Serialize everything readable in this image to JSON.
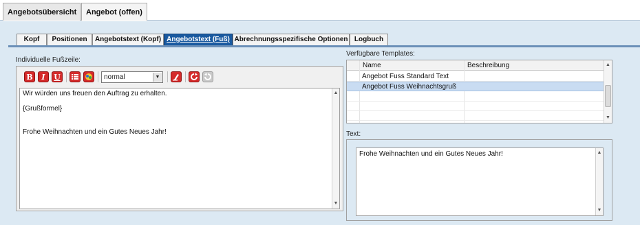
{
  "doc_tabs": [
    {
      "label": "Angebotsübersicht",
      "active": false
    },
    {
      "label": "Angebot (offen)",
      "active": true
    }
  ],
  "sub_tabs": [
    {
      "label": "Kopf",
      "active": false
    },
    {
      "label": "Positionen",
      "active": false
    },
    {
      "label": "Angebotstext (Kopf)",
      "active": false
    },
    {
      "label": "Angebotstext (Fuß)",
      "active": true
    },
    {
      "label": "Abrechnungsspezifische Optionen",
      "active": false
    },
    {
      "label": "Logbuch",
      "active": false
    }
  ],
  "footer_section": {
    "label": "Individuelle Fußzeile:",
    "toolbar": {
      "bold": "B",
      "italic": "I",
      "underline": "U",
      "format_select_value": "normal",
      "icons": [
        "bold-icon",
        "italic-icon",
        "underline-icon",
        "list-icon",
        "color-icon",
        "clear-format-icon",
        "undo-icon",
        "redo-icon"
      ]
    },
    "lines": [
      "Wir würden uns freuen den Auftrag zu erhalten.",
      "{Grußformel}",
      "",
      "Frohe Weihnachten und ein Gutes Neues Jahr!"
    ]
  },
  "templates": {
    "label": "Verfügbare Templates:",
    "columns": [
      "Name",
      "Beschreibung"
    ],
    "rows": [
      {
        "name": "Angebot Fuss Standard Text",
        "description": "",
        "selected": false
      },
      {
        "name": "Angebot Fuss Weihnachtsgruß",
        "description": "",
        "selected": true
      }
    ]
  },
  "text_section": {
    "label": "Text:",
    "value": "Frohe Weihnachten und ein Gutes Neues Jahr!"
  },
  "colors": {
    "accent": "#1a5aa0",
    "background": "#dce9f3",
    "toolbar_red": "#d42a2a",
    "selection": "#c9dcf2"
  }
}
